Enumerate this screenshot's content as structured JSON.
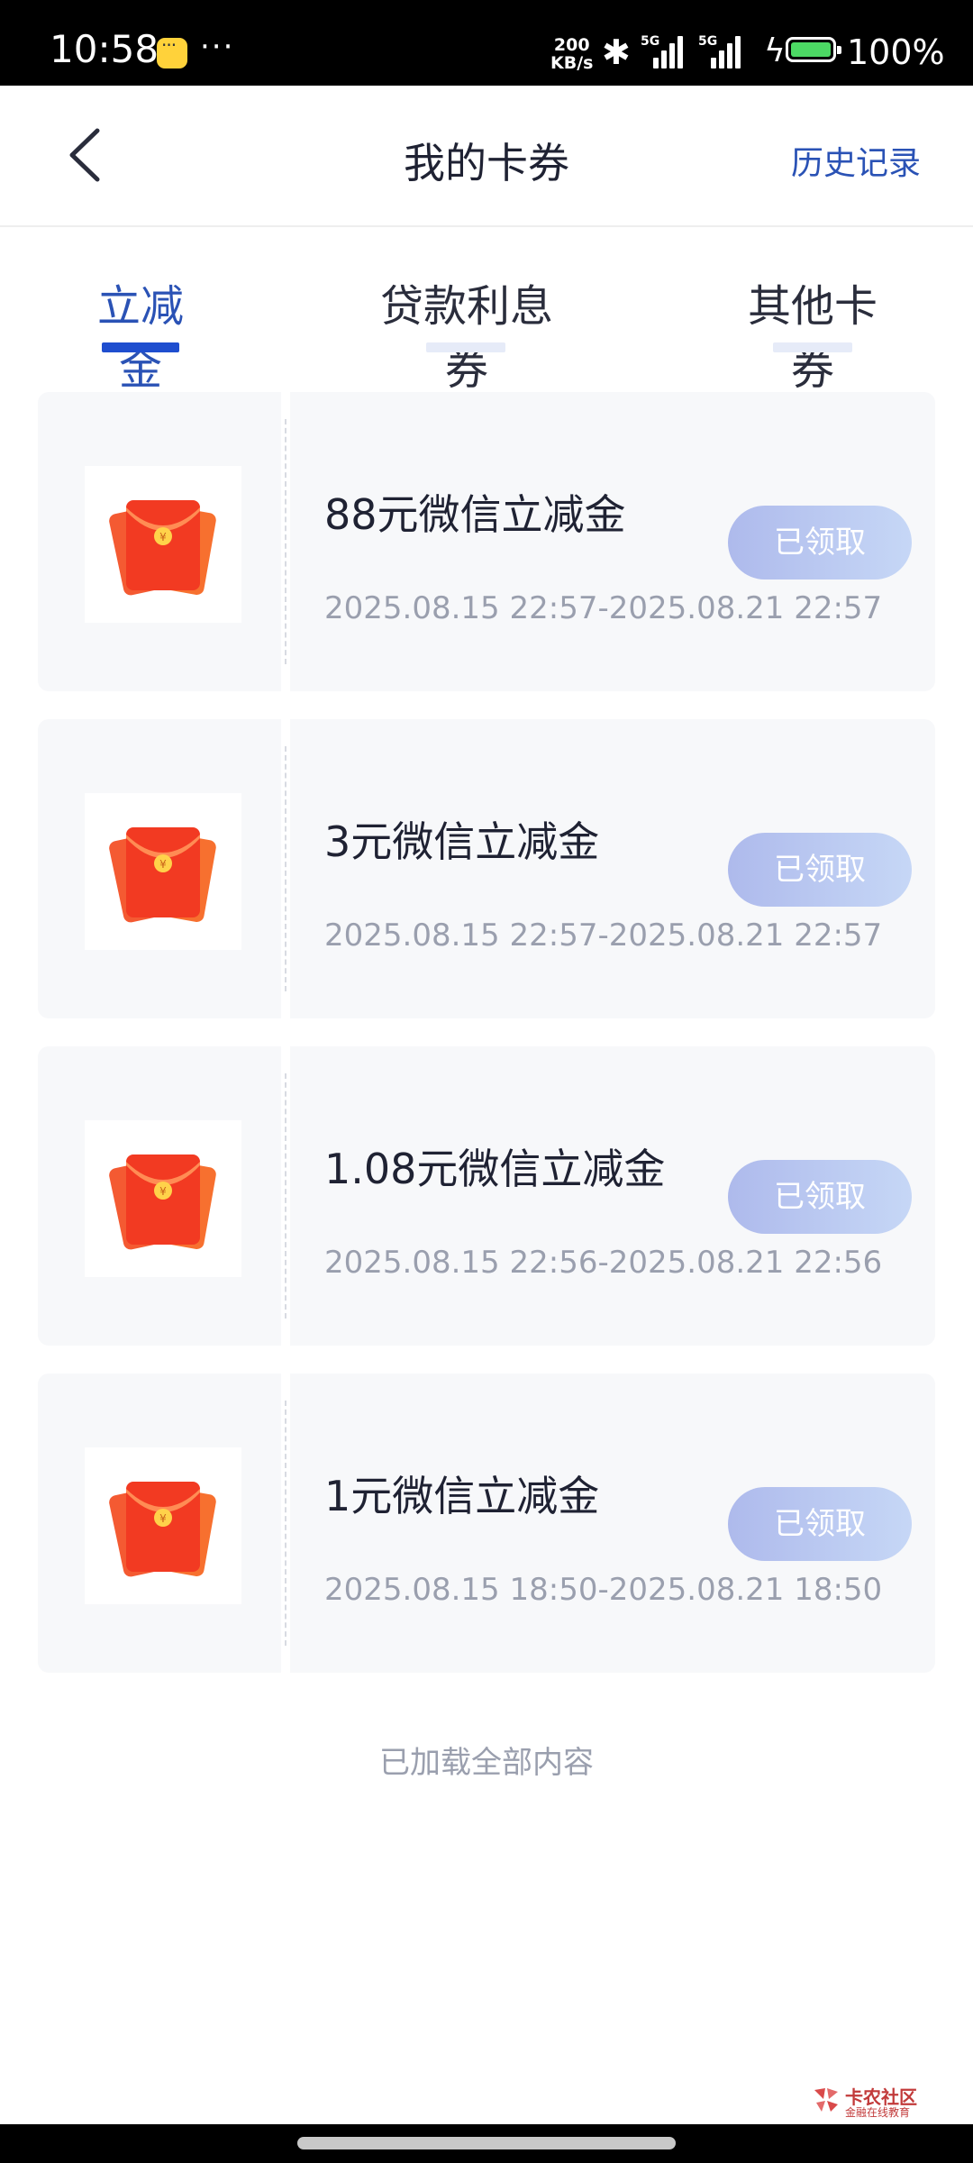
{
  "status_bar": {
    "time": "10:58",
    "more": "···",
    "net_speed_value": "200",
    "net_speed_unit": "KB/s",
    "signal_1": "5G",
    "signal_2": "5G",
    "battery_pct": "100%"
  },
  "nav": {
    "title": "我的卡券",
    "history_label": "历史记录"
  },
  "tabs": [
    {
      "label": "立减金",
      "active": true
    },
    {
      "label": "贷款利息券",
      "active": false
    },
    {
      "label": "其他卡券",
      "active": false
    }
  ],
  "coupons": [
    {
      "title": "88元微信立减金",
      "validity": "2025.08.15 22:57-2025.08.21 22:57",
      "button": "已领取",
      "icon": "red-envelope-icon"
    },
    {
      "title": "3元微信立减金",
      "validity": "2025.08.15 22:57-2025.08.21 22:57",
      "button": "已领取",
      "icon": "red-envelope-icon"
    },
    {
      "title": "1.08元微信立减金",
      "validity": "2025.08.15 22:56-2025.08.21 22:56",
      "button": "已领取",
      "icon": "red-envelope-icon"
    },
    {
      "title": "1元微信立减金",
      "validity": "2025.08.15 18:50-2025.08.21 18:50",
      "button": "已领取",
      "icon": "red-envelope-icon"
    }
  ],
  "end_note": "已加载全部内容",
  "watermark": {
    "name": "卡农社区",
    "sub": "金融在线教育"
  },
  "colors": {
    "accent": "#2a52b5",
    "card_bg": "#f7f8fa",
    "muted_text": "#9a9fae",
    "button_gradient_start": "#aebaec",
    "button_gradient_end": "#c6d7f6"
  }
}
